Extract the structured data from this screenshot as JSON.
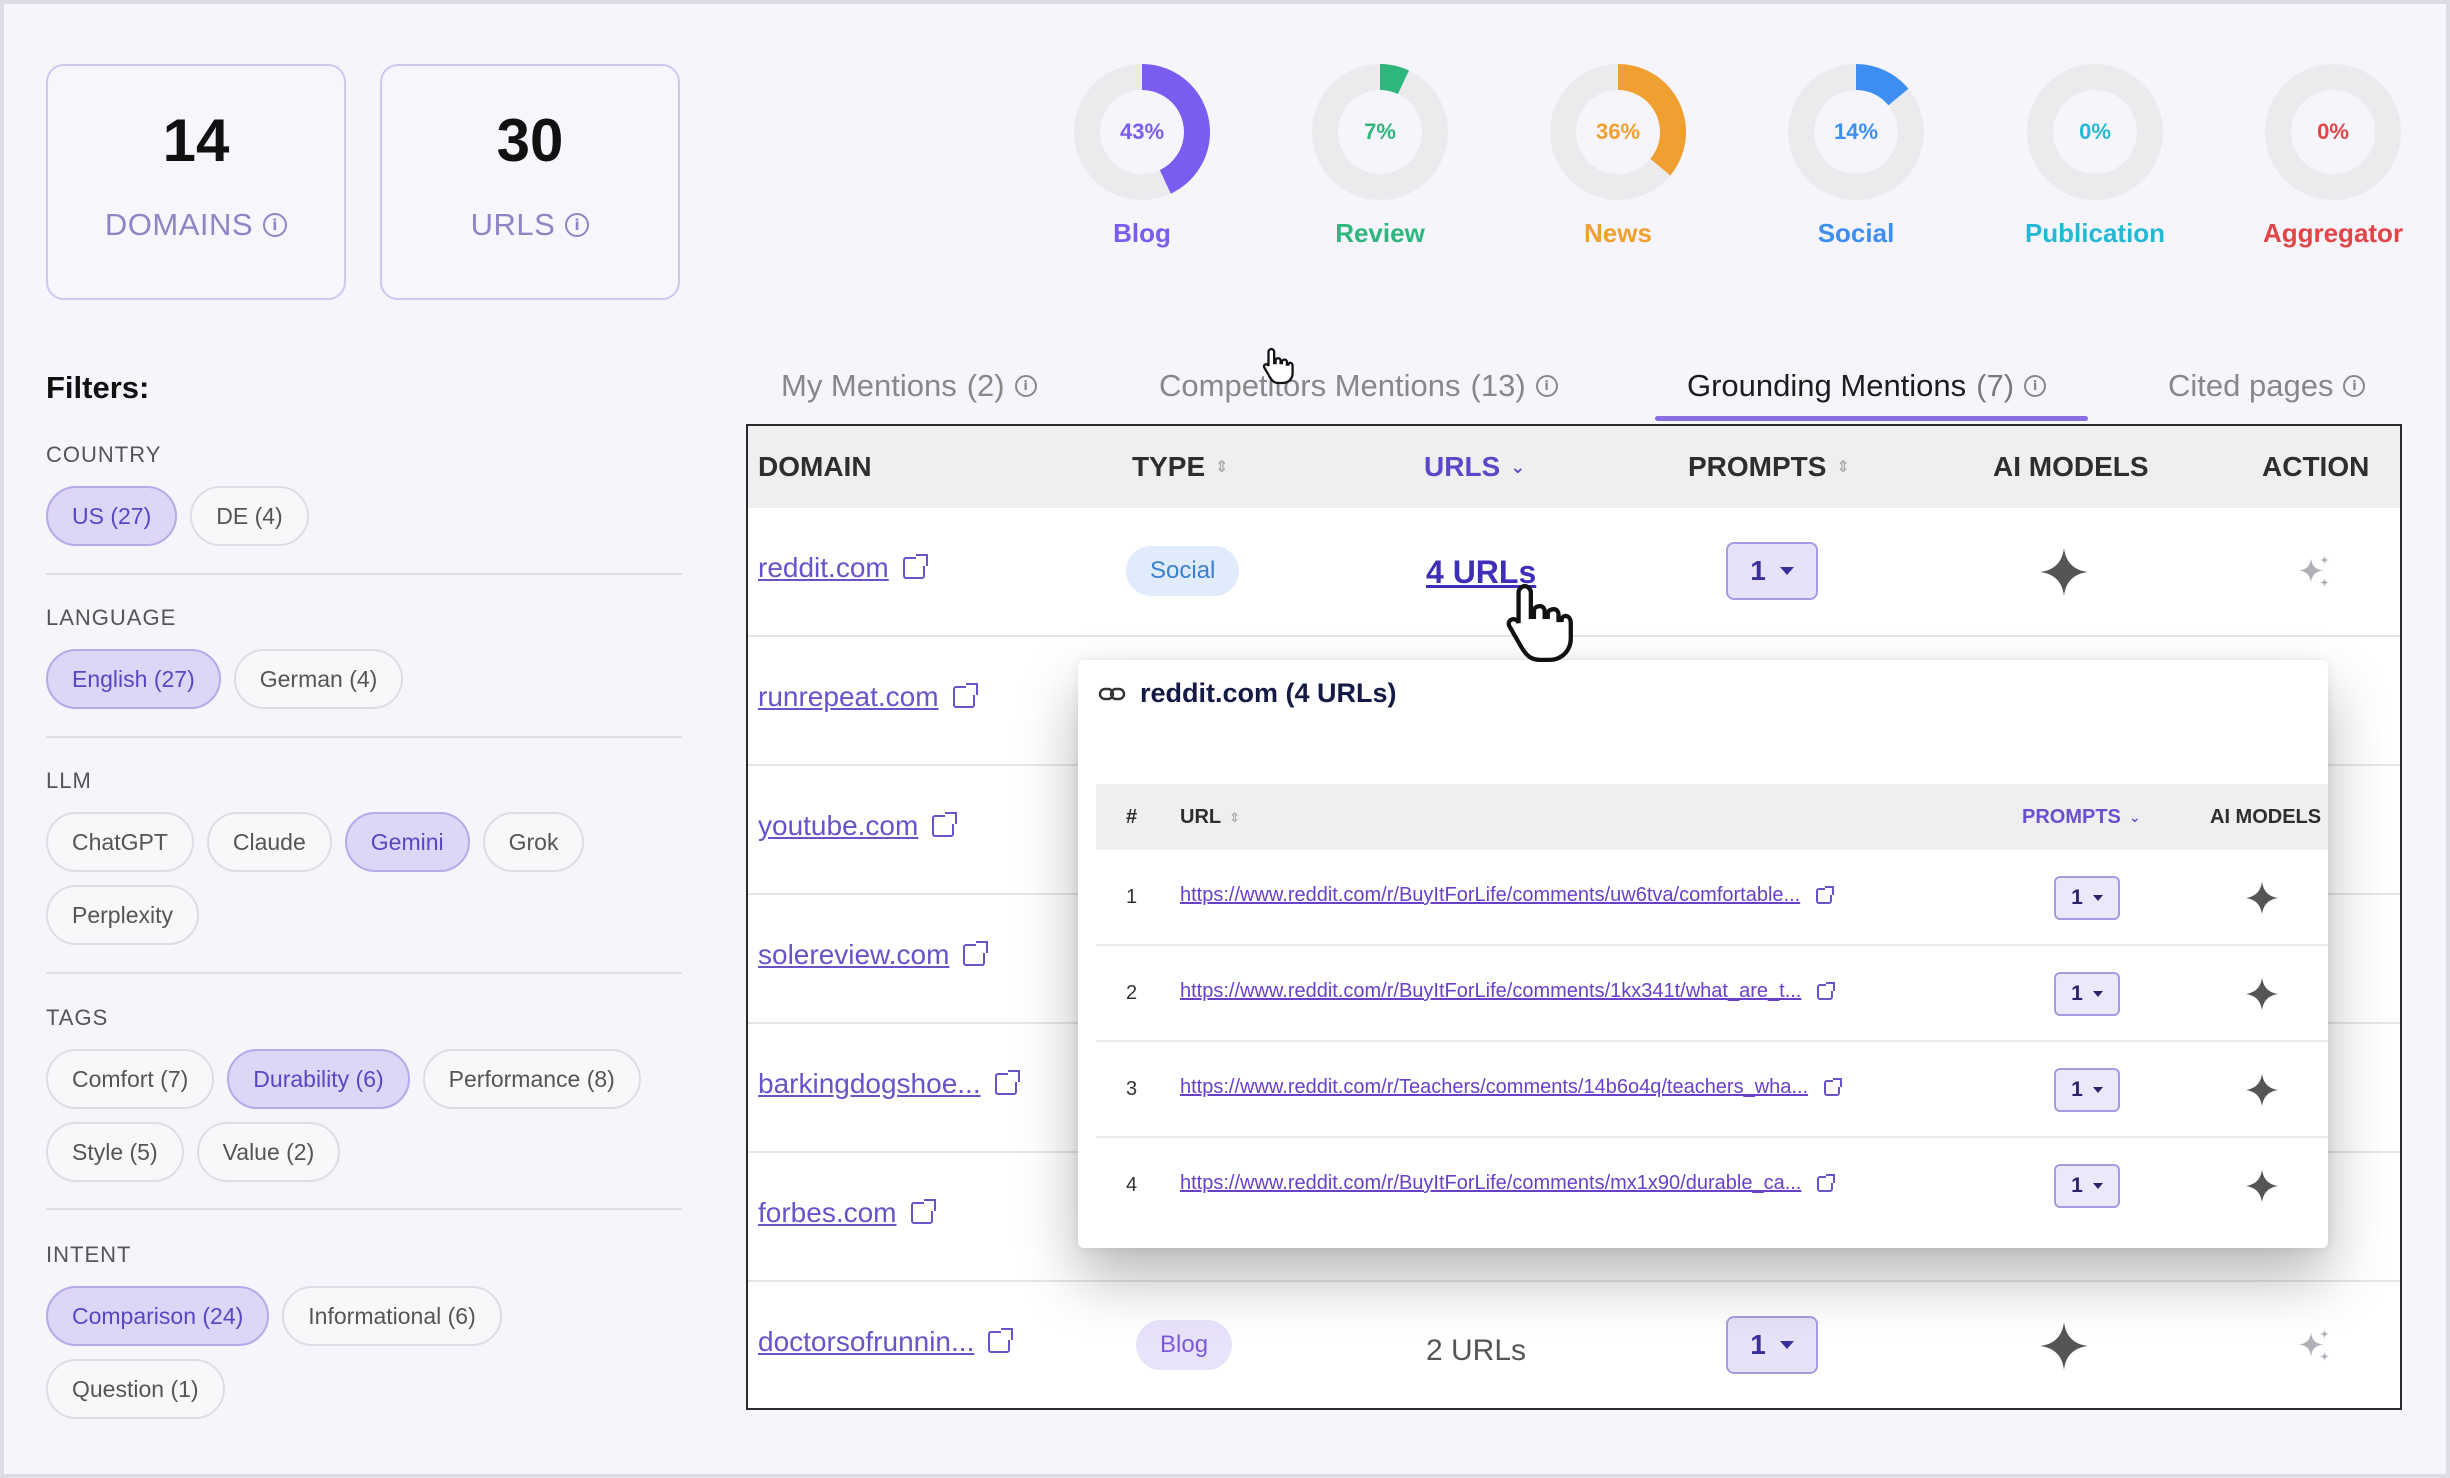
{
  "stats": {
    "domains": {
      "value": "14",
      "label": "DOMAINS"
    },
    "urls": {
      "value": "30",
      "label": "URLS"
    }
  },
  "categories": [
    {
      "label": "Blog",
      "pct": "43%",
      "value": 43,
      "color": "#7b5cf0"
    },
    {
      "label": "Review",
      "pct": "7%",
      "value": 7,
      "color": "#2eb67d"
    },
    {
      "label": "News",
      "pct": "36%",
      "value": 36,
      "color": "#f0a030"
    },
    {
      "label": "Social",
      "pct": "14%",
      "value": 14,
      "color": "#3d8ef0"
    },
    {
      "label": "Publication",
      "pct": "0%",
      "value": 0,
      "color": "#25b8d4"
    },
    {
      "label": "Aggregator",
      "pct": "0%",
      "value": 0,
      "color": "#e04646"
    }
  ],
  "filters": {
    "title": "Filters:",
    "country": {
      "label": "COUNTRY",
      "options": [
        "US (27)",
        "DE (4)"
      ]
    },
    "language": {
      "label": "LANGUAGE",
      "options": [
        "English (27)",
        "German (4)"
      ]
    },
    "llm": {
      "label": "LLM",
      "options": [
        "ChatGPT",
        "Claude",
        "Gemini",
        "Grok",
        "Perplexity"
      ]
    },
    "tags": {
      "label": "TAGS",
      "options": [
        "Comfort (7)",
        "Durability (6)",
        "Performance (8)",
        "Style (5)",
        "Value (2)"
      ]
    },
    "intent": {
      "label": "INTENT",
      "options": [
        "Comparison (24)",
        "Informational (6)",
        "Question (1)"
      ]
    }
  },
  "tabs": {
    "my": {
      "label": "My Mentions",
      "count": "(2)"
    },
    "competitors": {
      "label": "Competitors Mentions",
      "count": "(13)"
    },
    "grounding": {
      "label": "Grounding Mentions",
      "count": "(7)"
    },
    "cited": {
      "label": "Cited pages",
      "count": ""
    }
  },
  "table": {
    "headers": {
      "domain": "DOMAIN",
      "type": "TYPE",
      "urls": "URLS",
      "prompts": "PROMPTS",
      "ai_models": "AI MODELS",
      "action": "ACTION"
    },
    "rows": [
      {
        "domain": "reddit.com",
        "type": "Social",
        "urls": "4 URLs",
        "prompts": "1"
      },
      {
        "domain": "runrepeat.com"
      },
      {
        "domain": "youtube.com"
      },
      {
        "domain": "solereview.com"
      },
      {
        "domain": "barkingdogshoe..."
      },
      {
        "domain": "forbes.com"
      },
      {
        "domain": "doctorsofrunnin...",
        "type": "Blog",
        "urls": "2 URLs",
        "prompts": "1"
      }
    ]
  },
  "popup": {
    "title": "reddit.com (4 URLs)",
    "headers": {
      "num": "#",
      "url": "URL",
      "prompts": "PROMPTS",
      "ai_models": "AI MODELS"
    },
    "rows": [
      {
        "num": "1",
        "url": "https://www.reddit.com/r/BuyItForLife/comments/uw6tva/comfortable...",
        "prompts": "1"
      },
      {
        "num": "2",
        "url": "https://www.reddit.com/r/BuyItForLife/comments/1kx341t/what_are_t...",
        "prompts": "1"
      },
      {
        "num": "3",
        "url": "https://www.reddit.com/r/Teachers/comments/14b6o4q/teachers_wha...",
        "prompts": "1"
      },
      {
        "num": "4",
        "url": "https://www.reddit.com/r/BuyItForLife/comments/mx1x90/durable_ca...",
        "prompts": "1"
      }
    ]
  }
}
